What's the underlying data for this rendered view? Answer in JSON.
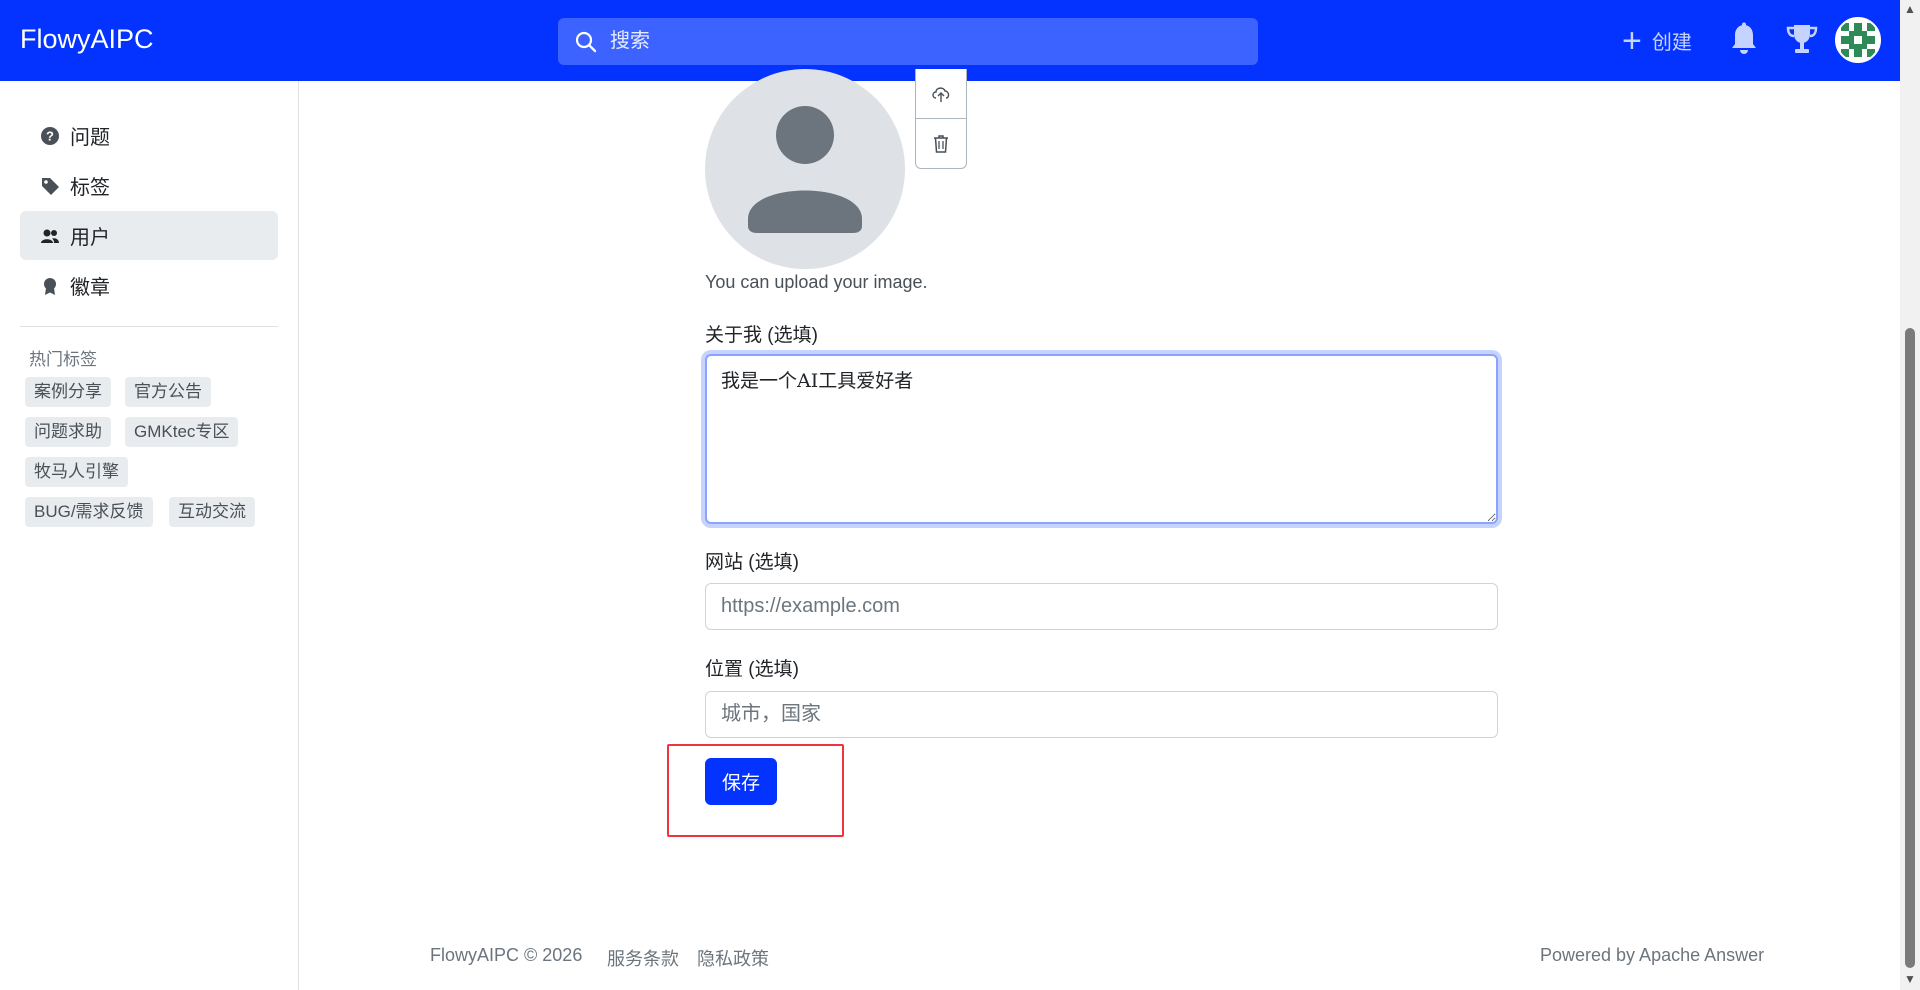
{
  "header": {
    "brand": "FlowyAIPC",
    "search_placeholder": "搜索",
    "create_label": "创建",
    "icons": [
      "search-icon",
      "plus-icon",
      "bell-icon",
      "trophy-icon"
    ],
    "accent": "#0433ff"
  },
  "sidebar": {
    "items": [
      {
        "label": "问题",
        "icon": "question-circle-icon",
        "active": false
      },
      {
        "label": "标签",
        "icon": "tags-icon",
        "active": false
      },
      {
        "label": "用户",
        "icon": "people-icon",
        "active": true
      },
      {
        "label": "徽章",
        "icon": "award-icon",
        "active": false
      }
    ],
    "hot_tags_title": "热门标签",
    "hot_tags": [
      "案例分享",
      "官方公告",
      "问题求助",
      "GMKtec专区",
      "牧马人引擎",
      "BUG/需求反馈",
      "互动交流"
    ]
  },
  "profile_form": {
    "upload_hint": "You can upload your image.",
    "about_label": "关于我 (选填)",
    "about_value": "我是一个AI工具爱好者",
    "website_label": "网站 (选填)",
    "website_placeholder": "https://example.com",
    "location_label": "位置 (选填)",
    "location_placeholder": "城市，国家",
    "save_label": "保存"
  },
  "footer": {
    "copyright": "FlowyAIPC © 2026",
    "terms": "服务条款",
    "privacy": "隐私政策",
    "powered_by": "Powered by Apache Answer"
  }
}
